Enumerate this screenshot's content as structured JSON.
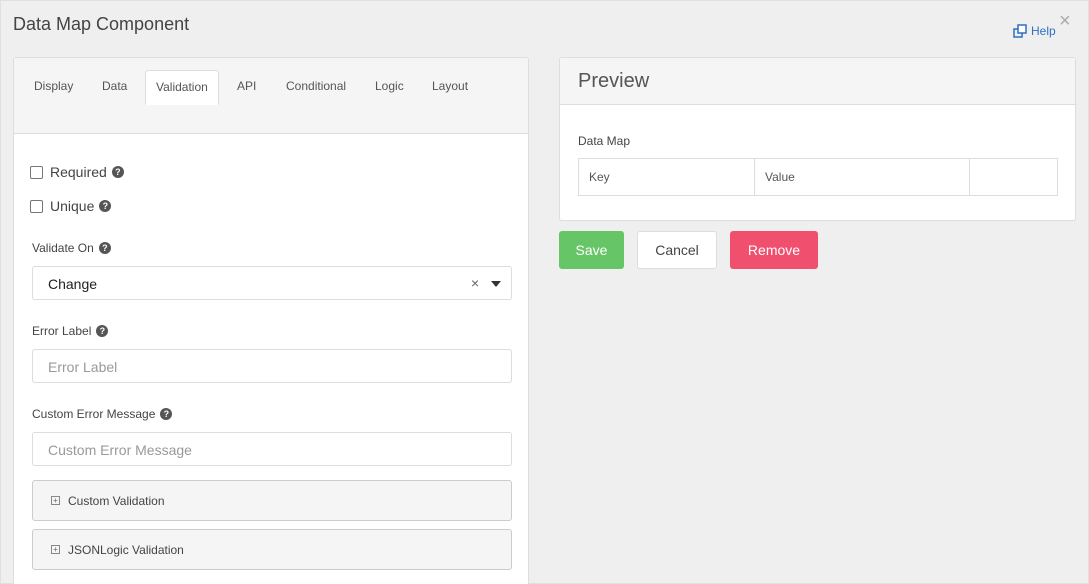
{
  "modal": {
    "title": "Data Map Component",
    "help_label": "Help",
    "close_glyph": "×"
  },
  "tabs": [
    {
      "label": "Display"
    },
    {
      "label": "Data"
    },
    {
      "label": "Validation",
      "active": true
    },
    {
      "label": "API"
    },
    {
      "label": "Conditional"
    },
    {
      "label": "Logic"
    },
    {
      "label": "Layout"
    }
  ],
  "validation": {
    "required_label": "Required",
    "unique_label": "Unique",
    "validate_on_label": "Validate On",
    "validate_on_value": "Change",
    "error_label_label": "Error Label",
    "error_label_placeholder": "Error Label",
    "custom_error_label": "Custom Error Message",
    "custom_error_placeholder": "Custom Error Message",
    "custom_validation_label": "Custom Validation",
    "jsonlogic_validation_label": "JSONLogic Validation"
  },
  "preview": {
    "title": "Preview",
    "field_label": "Data Map",
    "key_header": "Key",
    "value_header": "Value"
  },
  "actions": {
    "save_label": "Save",
    "cancel_label": "Cancel",
    "remove_label": "Remove"
  },
  "colors": {
    "save": "#66c566",
    "remove": "#f0506e",
    "link": "#2f6fc4"
  }
}
